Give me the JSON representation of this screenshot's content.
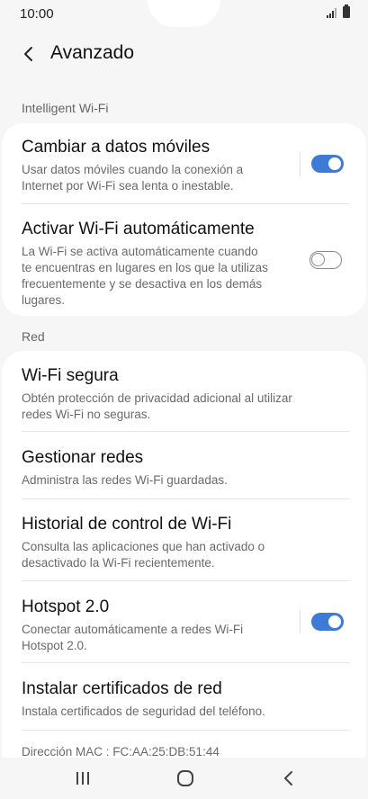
{
  "status": {
    "time": "10:00"
  },
  "header": {
    "title": "Avanzado"
  },
  "sections": {
    "intelligent": "Intelligent Wi-Fi",
    "red": "Red"
  },
  "intelligent_items": [
    {
      "title": "Cambiar a datos móviles",
      "subtitle_lines": [
        "Usar datos móviles cuando la conexión a",
        "Internet por Wi-Fi sea lenta o inestable."
      ],
      "toggle": true
    },
    {
      "title": "Activar Wi-Fi automáticamente",
      "subtitle_lines": [
        "La Wi-Fi se activa automáticamente cuando",
        "te encuentras en lugares en los que la utilizas",
        "frecuentemente y se desactiva en los demás",
        "lugares."
      ],
      "toggle": false
    }
  ],
  "red_items": [
    {
      "title": "Wi-Fi segura",
      "subtitle_lines": [
        "Obtén protección de privacidad adicional al utilizar",
        "redes Wi-Fi no seguras."
      ]
    },
    {
      "title": "Gestionar redes",
      "subtitle_lines": [
        "Administra las redes Wi-Fi guardadas."
      ]
    },
    {
      "title": "Historial de control de Wi-Fi",
      "subtitle_lines": [
        "Consulta las aplicaciones que han activado o",
        "desactivado la Wi-Fi recientemente."
      ]
    },
    {
      "title": "Hotspot 2.0",
      "subtitle_lines": [
        "Conectar automáticamente a redes Wi-Fi",
        "Hotspot 2.0."
      ],
      "toggle": true
    },
    {
      "title": "Instalar certificados de red",
      "subtitle_lines": [
        "Instala certificados de seguridad del teléfono."
      ]
    }
  ],
  "mac_address": "Dirección MAC : FC:AA:25:DB:51:44",
  "colors": {
    "accent": "#3e7bd6",
    "background": "#f6f6f6",
    "card": "#ffffff"
  },
  "icons": {
    "back": "chevron-left-icon",
    "recents": "recents-icon",
    "home": "home-icon",
    "nav_back": "nav-back-icon"
  }
}
